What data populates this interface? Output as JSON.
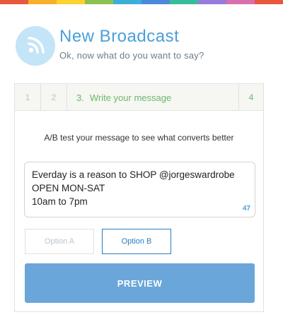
{
  "top_bar_colors": [
    "#e9573f",
    "#f6b02b",
    "#fdd130",
    "#8cc152",
    "#3bafda",
    "#4a89dc",
    "#37bc9b",
    "#967adc",
    "#d770ad",
    "#e9573f"
  ],
  "header": {
    "icon": "rss-icon",
    "title": "New Broadcast",
    "subtitle": "Ok, now what do you want to say?"
  },
  "steps": {
    "step1": "1",
    "step2": "2",
    "active_number": "3.",
    "active_label": "Write your message",
    "step4": "4"
  },
  "ab_text": "A/B test your message to see what converts better",
  "message": {
    "lines": [
      "Everday is a reason to SHOP @jorgeswardrobe",
      "OPEN MON-SAT",
      "10am to 7pm"
    ],
    "char_count": "47"
  },
  "options": {
    "a_label": "Option A",
    "b_label": "Option B",
    "selected": "Option B"
  },
  "preview_label": "PREVIEW",
  "colors": {
    "accent": "#4a9fd8",
    "step_active": "#6cb86c",
    "preview_button": "#6aa6d9",
    "selected_option": "#2a7cc1"
  }
}
